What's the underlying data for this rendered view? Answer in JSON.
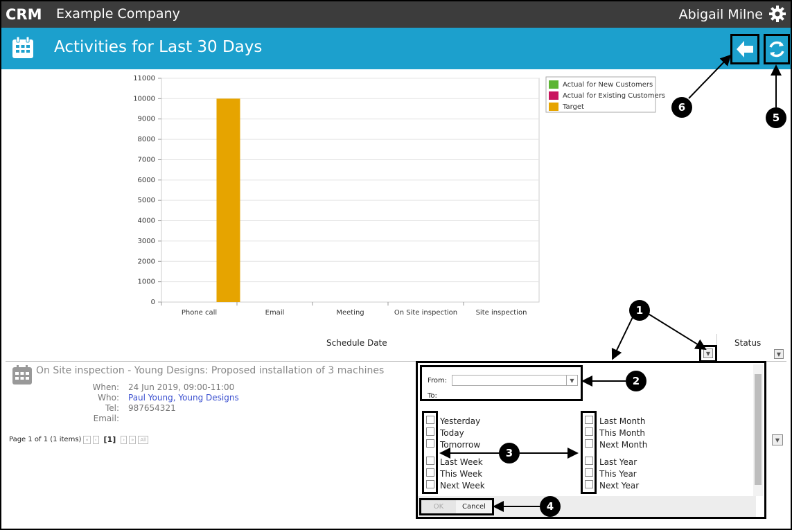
{
  "topbar": {
    "logo": "CRM",
    "company": "Example Company",
    "user": "Abigail Milne"
  },
  "header": {
    "title": "Activities for Last 30 Days"
  },
  "chart_data": {
    "type": "bar",
    "categories": [
      "Phone call",
      "Email",
      "Meeting",
      "On Site inspection",
      "Site inspection"
    ],
    "series": [
      {
        "name": "Actual for New Customers",
        "color": "#5cb533",
        "values": [
          0,
          0,
          0,
          0,
          0
        ]
      },
      {
        "name": "Actual for Existing Customers",
        "color": "#c8155e",
        "values": [
          0,
          0,
          0,
          0,
          0
        ]
      },
      {
        "name": "Target",
        "color": "#e6a400",
        "values": [
          10000,
          0,
          0,
          0,
          0
        ]
      }
    ],
    "ylim": [
      0,
      11000
    ],
    "yticks": [
      "0",
      "1000",
      "2000",
      "3000",
      "4000",
      "5000",
      "6000",
      "7000",
      "8000",
      "9000",
      "10000",
      "11000"
    ],
    "grid": true,
    "legend": "top-right"
  },
  "list": {
    "col_schedule": "Schedule Date",
    "col_status": "Status",
    "activity_title": "On Site inspection - Young Designs: Proposed installation of 3 machines",
    "labels": {
      "when": "When:",
      "who": "Who:",
      "tel": "Tel:",
      "email": "Email:"
    },
    "when": "24 Jun 2019, 09:00-11:00",
    "who": "Paul Young, Young Designs",
    "tel": "987654321",
    "email": ""
  },
  "pager": {
    "text": "Page 1 of 1 (1 items)",
    "first": "«",
    "prev": "‹",
    "current": "[1]",
    "next": "›",
    "last": "»",
    "all": "All"
  },
  "filter": {
    "from": "From:",
    "to": "To:",
    "left_options": [
      "Yesterday",
      "Today",
      "Tomorrow",
      "Last Week",
      "This Week",
      "Next Week"
    ],
    "right_options": [
      "Last Month",
      "This Month",
      "Next Month",
      "Last Year",
      "This Year",
      "Next Year"
    ],
    "ok": "OK",
    "cancel": "Cancel"
  },
  "callouts": [
    "1",
    "2",
    "3",
    "4",
    "5",
    "6"
  ]
}
